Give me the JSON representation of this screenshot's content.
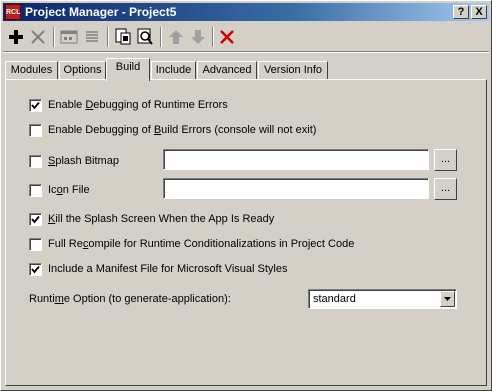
{
  "window": {
    "title": "Project Manager - Project5",
    "icon_text": "RCL",
    "help_label": "?",
    "close_label": "X"
  },
  "toolbar": {
    "items": [
      "add-icon",
      "remove-icon",
      "window-icon",
      "list-icon",
      "build-icon",
      "search-icon",
      "move-up-icon",
      "move-down-icon",
      "delete-icon"
    ]
  },
  "tabs": [
    {
      "label": "Modules"
    },
    {
      "label": "Options"
    },
    {
      "label": "Build",
      "active": true
    },
    {
      "label": "Include"
    },
    {
      "label": "Advanced"
    },
    {
      "label": "Version Info"
    }
  ],
  "build": {
    "debug_runtime": {
      "pre": "Enable ",
      "u": "D",
      "post": "ebugging of Runtime Errors",
      "checked": true
    },
    "debug_build": {
      "pre": "Enable Debugging of ",
      "u": "B",
      "post": "uild Errors (console will not exit)",
      "checked": false
    },
    "splash_bitmap": {
      "pre": "",
      "u": "S",
      "post": "plash Bitmap",
      "checked": false,
      "value": ""
    },
    "icon_file": {
      "pre": "Ic",
      "u": "o",
      "post": "n File",
      "checked": false,
      "value": ""
    },
    "kill_splash": {
      "pre": "",
      "u": "K",
      "post": "ill the Splash Screen When the App Is Ready",
      "checked": true
    },
    "full_recompile": {
      "pre": "Full Re",
      "u": "c",
      "post": "ompile for Runtime Conditionalizations in Project Code",
      "checked": false
    },
    "manifest": {
      "pre": "Include a Manifest File for Microsoft Visual Styles",
      "u": "",
      "post": "",
      "checked": true
    },
    "browse_label": "...",
    "runtime_option": {
      "pre": "Runti",
      "u": "m",
      "post": "e Option (to generate-application):",
      "value": "standard"
    }
  },
  "colors": {
    "title_start": "#0a246a",
    "title_end": "#a6caf0",
    "delete_red": "#cc0000",
    "face": "#d4d0c8"
  }
}
